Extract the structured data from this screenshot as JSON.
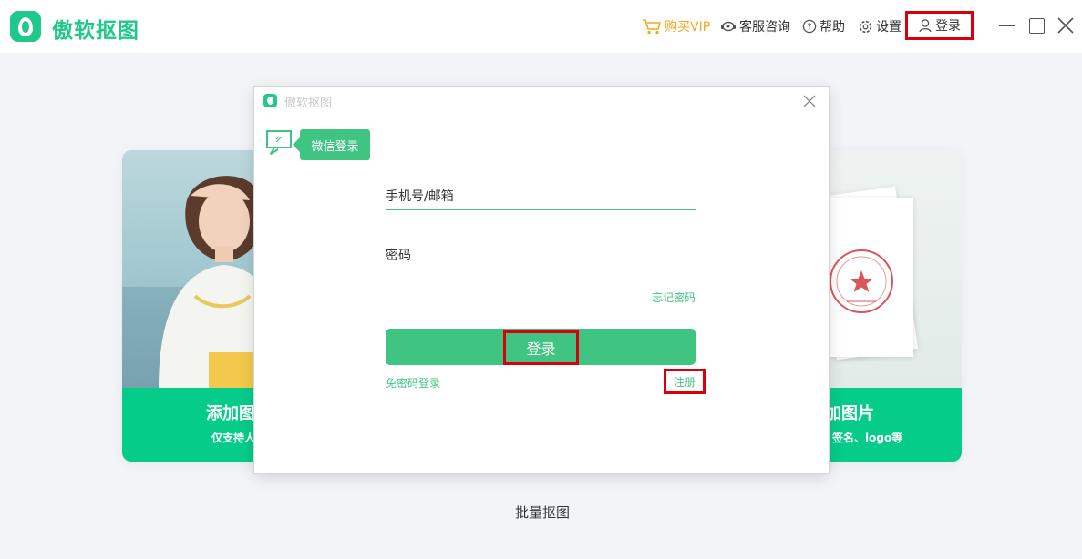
{
  "app": {
    "name": "傲软抠图"
  },
  "header": {
    "buy_vip": "购买VIP",
    "service": "客服咨询",
    "help": "帮助",
    "settings": "设置",
    "login": "登录",
    "vip_color": "#f5a623"
  },
  "cards": {
    "left": {
      "title": "添加图",
      "subtitle": "仅支持人"
    },
    "right": {
      "title": "加图片",
      "subtitle": "签名、logo等"
    }
  },
  "batch_label": "批量抠图",
  "dialog": {
    "title": "傲软抠图",
    "wechat_tab": "微信登录",
    "phone_placeholder": "手机号/邮箱",
    "password_placeholder": "密码",
    "forgot": "忘记密码",
    "login_button": "登录",
    "no_password_login": "免密码登录",
    "register": "注册"
  },
  "theme": {
    "accent": "#3fc581",
    "brand": "#1fc98a",
    "highlight": "#d9000d"
  }
}
